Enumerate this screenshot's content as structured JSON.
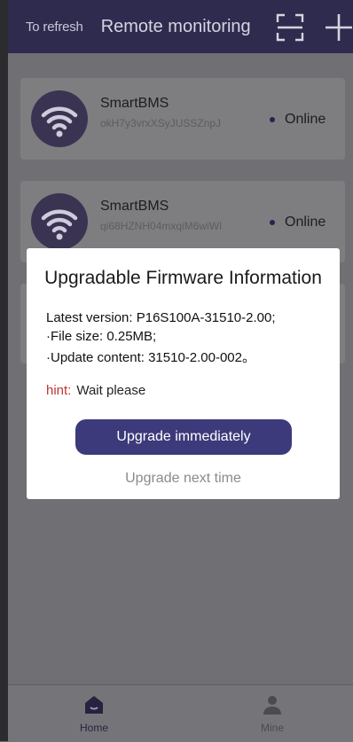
{
  "header": {
    "refresh_label": "To refresh",
    "title": "Remote monitoring"
  },
  "devices": [
    {
      "name": "SmartBMS",
      "id": "okH7y3vrxXSyJUSSZnpJ",
      "status": "Online"
    },
    {
      "name": "SmartBMS",
      "id": "qi68HZNH04mxqiM6wiWI",
      "status": "Online"
    }
  ],
  "modal": {
    "title": "Upgradable Firmware Information",
    "latest_version": "Latest version:  P16S100A-31510-2.00;",
    "file_size": "·File size:  0.25MB;",
    "update_content": "·Update content:  31510-2.00-002。",
    "hint_label": "hint:",
    "hint_value": "Wait please",
    "upgrade_button": "Upgrade immediately",
    "later_button": "Upgrade next time"
  },
  "nav": {
    "home_label": "Home",
    "mine_label": "Mine"
  },
  "colors": {
    "header_bg": "#2f2b4e",
    "accent": "#3c3a7a",
    "hint": "#c23232",
    "overlay": "#707074"
  },
  "icons": {
    "scan": "scan-icon",
    "add": "plus-icon",
    "device": "wifi-icon",
    "home": "home-icon",
    "mine": "user-icon"
  }
}
